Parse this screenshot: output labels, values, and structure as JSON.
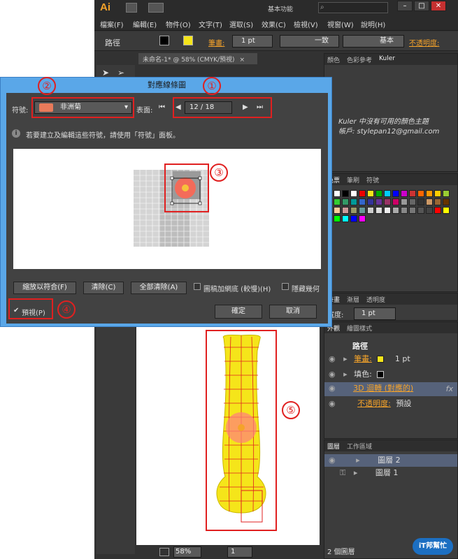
{
  "app": {
    "logo": "Ai",
    "workspace": "基本功能",
    "search_placeholder": ""
  },
  "menu": [
    "檔案(F)",
    "編輯(E)",
    "物件(O)",
    "文字(T)",
    "選取(S)",
    "效果(C)",
    "檢視(V)",
    "視窗(W)",
    "說明(H)"
  ],
  "control_bar": {
    "object_label": "路徑",
    "stroke_label": "筆畫:",
    "stroke_value": "1 pt",
    "profile": "一致",
    "brush": "基本",
    "opacity_label": "不透明度:"
  },
  "document_tab": "未命名-1* @ 58% (CMYK/預視)",
  "panels": {
    "color_tabs": [
      "顏色",
      "色彩參考",
      "Kuler"
    ],
    "kuler_message": "Kuler 中沒有可用的顏色主題",
    "kuler_account": "帳戶: stylepan12@gmail.com",
    "swatch_tabs": [
      "色票",
      "筆刷",
      "符號"
    ],
    "stroke_tabs": [
      "筆畫",
      "漸層",
      "透明度"
    ],
    "stroke_weight_label": "寬度:",
    "stroke_weight": "1 pt",
    "appearance_tabs": [
      "外觀",
      "繪圖樣式"
    ],
    "appearance_title": "路徑",
    "appearance_rows": [
      {
        "label": "筆畫:",
        "value": "1 pt",
        "orange": true
      },
      {
        "label": "填色:",
        "value": "",
        "orange": false
      },
      {
        "label": "3D 迴轉 (對應的)",
        "value": "fx",
        "orange": true
      },
      {
        "label": "不透明度:",
        "value": "預設",
        "orange": true
      }
    ],
    "layers_tabs": [
      "圖層",
      "工作區域"
    ],
    "layers": [
      {
        "name": "圖層 2"
      },
      {
        "name": "圖層 1"
      }
    ],
    "layers_count": "2 個圖層"
  },
  "dialog": {
    "title": "對應線條圖",
    "symbol_label": "符號:",
    "symbol_value": "非洲菊",
    "surface_label": "表面:",
    "surface_value": "12 / 18",
    "info_text": "若要建立及編輯這些符號，請使用「符號」面板。",
    "btn_fit": "縮放以符合(F)",
    "btn_clear": "清除(C)",
    "btn_clear_all": "全部清除(A)",
    "chk_shade": "圖稿加網底 (較慢)(H)",
    "chk_hide": "隱藏幾何",
    "chk_preview": "預視(P)",
    "btn_ok": "確定",
    "btn_cancel": "取消"
  },
  "annotations": [
    "①",
    "②",
    "③",
    "④",
    "⑤"
  ],
  "status": {
    "zoom": "58%",
    "page": "1"
  },
  "watermark": {
    "text": "iT邦幫忙"
  },
  "colors": {
    "accent": "#e02020",
    "dialog_frame": "#5aa7e8",
    "app_bg": "#323232",
    "orange_text": "#f5a32a"
  }
}
